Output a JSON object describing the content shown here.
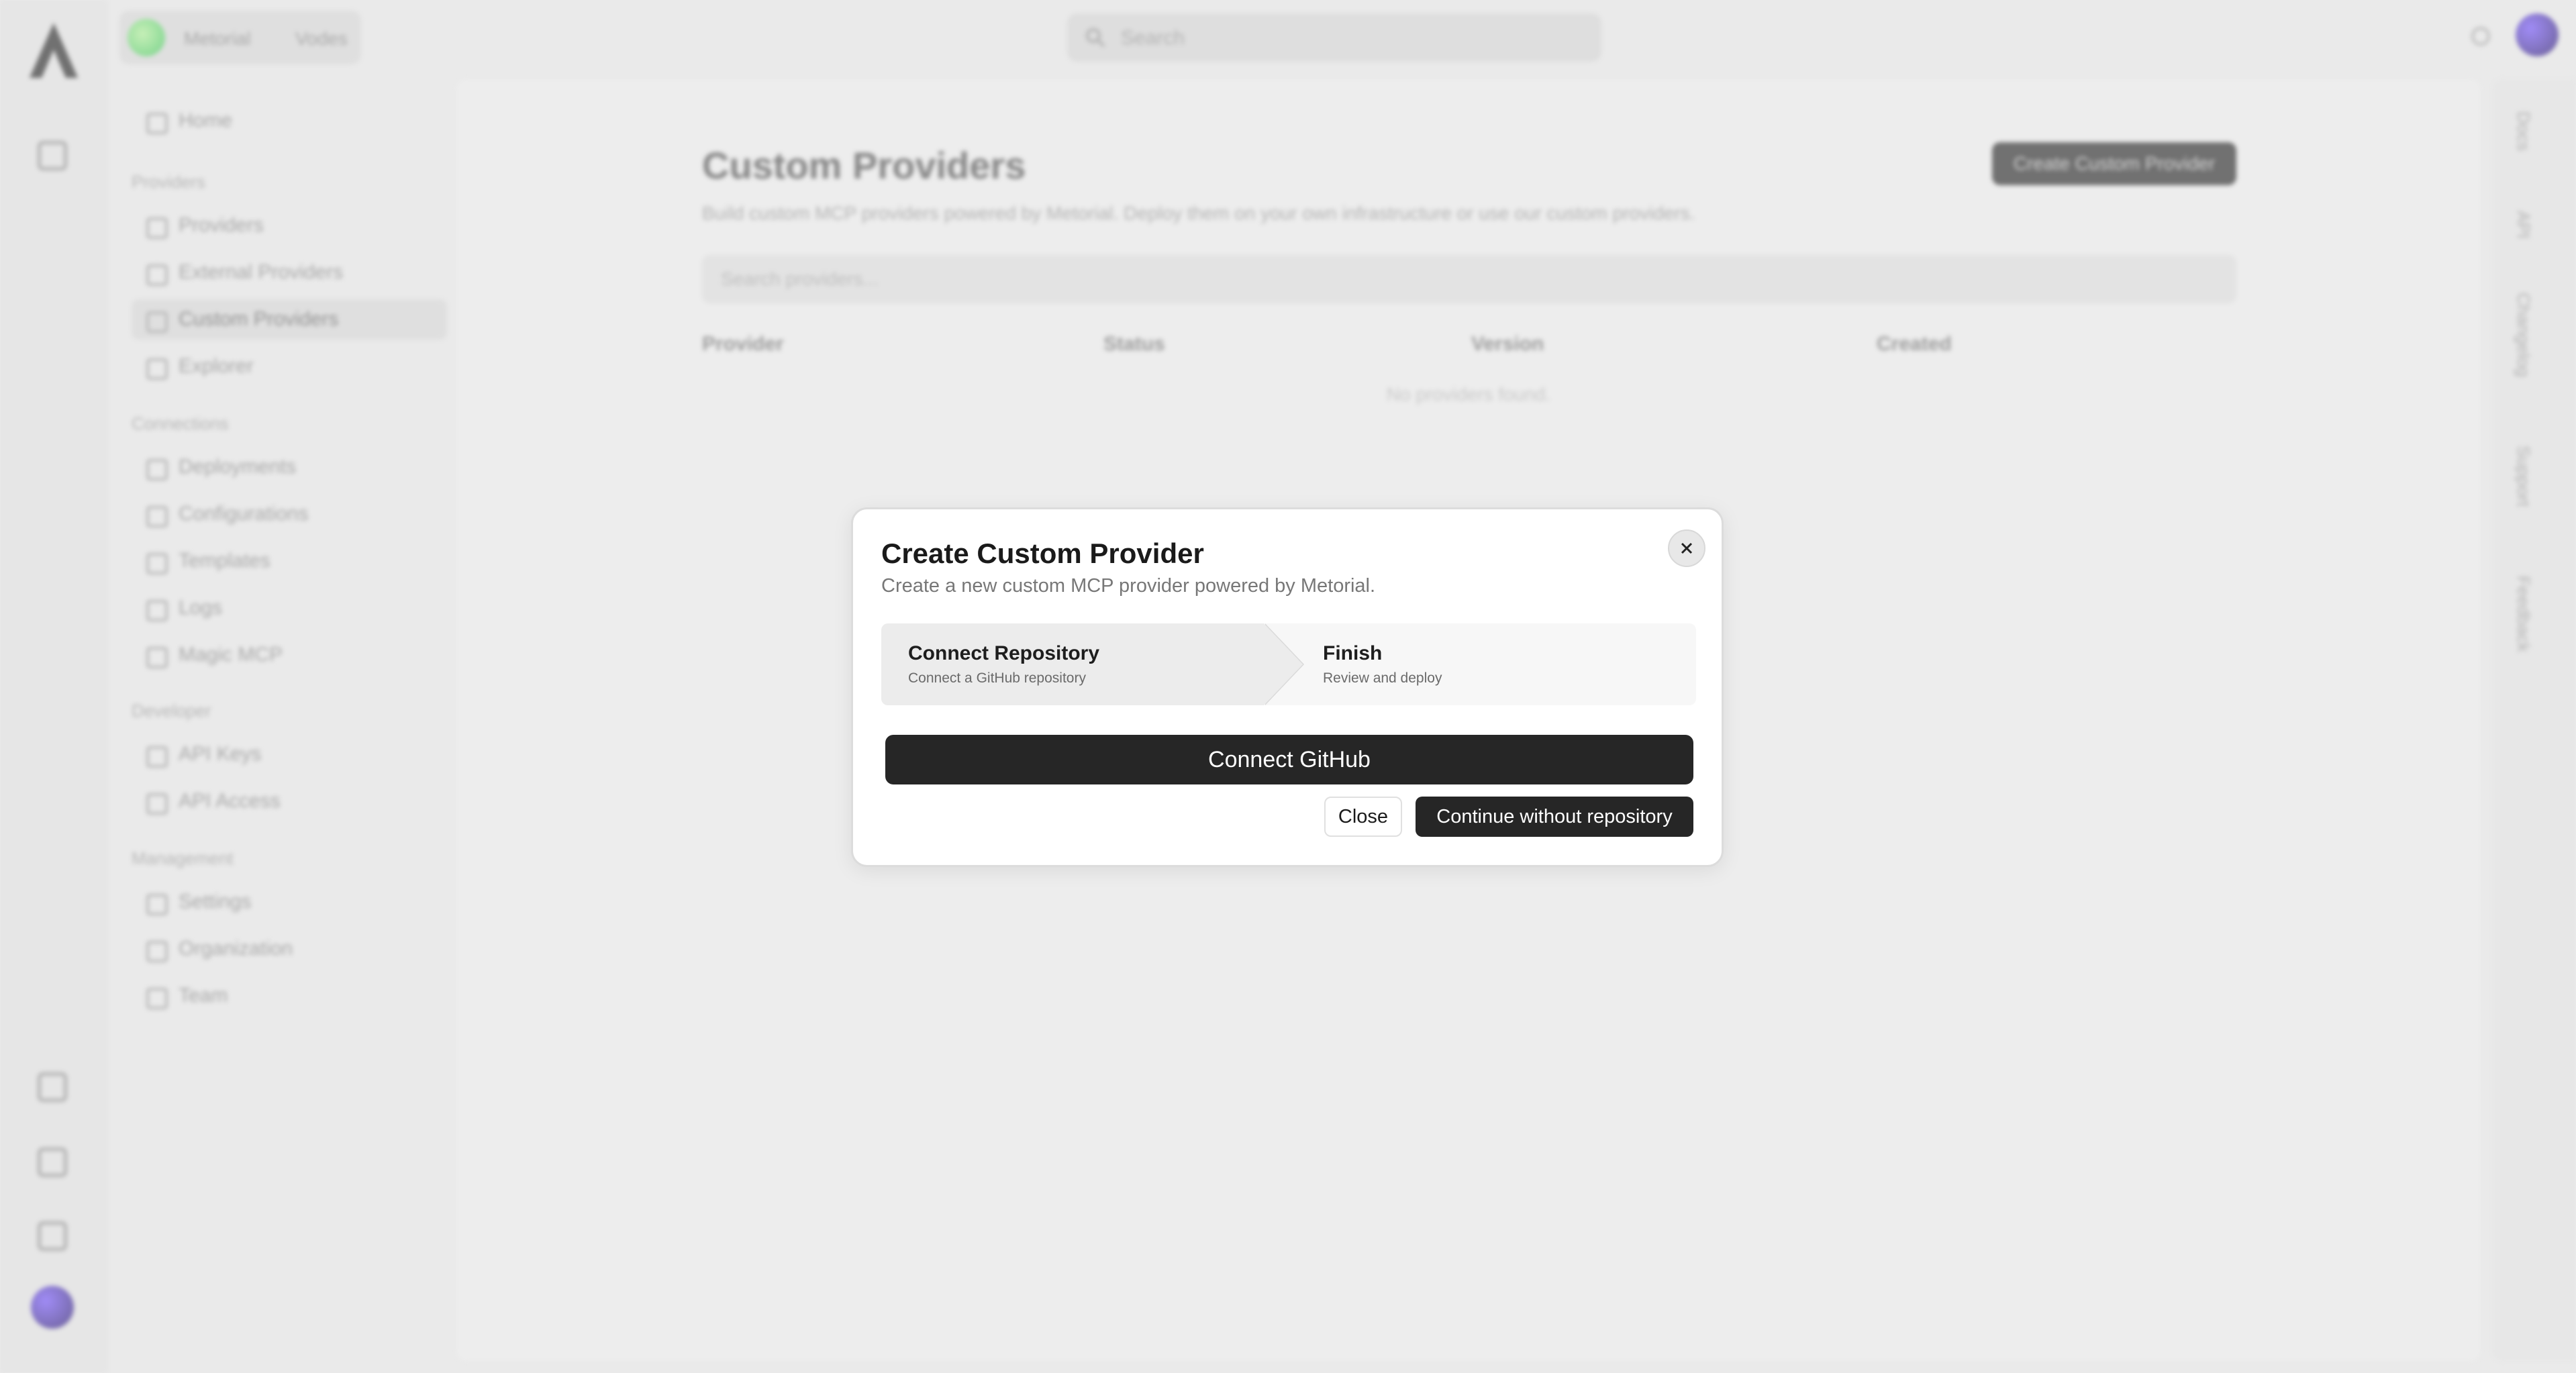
{
  "background": {
    "org": {
      "name": "Metorial",
      "project": "Vodes"
    },
    "search_placeholder": "Search",
    "sidebar": {
      "home": "Home",
      "groups": [
        {
          "label": "Providers",
          "items": [
            "Providers",
            "External Providers",
            "Custom Providers",
            "Explorer"
          ]
        },
        {
          "label": "Connections",
          "items": [
            "Deployments",
            "Configurations",
            "Templates",
            "Logs",
            "Magic MCP"
          ]
        },
        {
          "label": "Developer",
          "items": [
            "API Keys",
            "API Access"
          ]
        },
        {
          "label": "Management",
          "items": [
            "Settings",
            "Organization",
            "Team"
          ]
        }
      ],
      "active_item": "Custom Providers"
    },
    "main": {
      "title": "Custom Providers",
      "subtitle": "Build custom MCP providers powered by Metorial. Deploy them on your own infrastructure or use our custom providers.",
      "create_button": "Create Custom Provider",
      "search_placeholder": "Search providers...",
      "columns": [
        "Provider",
        "Status",
        "Version",
        "Created"
      ],
      "empty_text": "No providers found."
    },
    "right_tabs": [
      "Docs",
      "API",
      "Changelog",
      "Support",
      "Feedback"
    ]
  },
  "modal": {
    "title": "Create Custom Provider",
    "description": "Create a new custom MCP provider powered by Metorial.",
    "steps": [
      {
        "title": "Connect Repository",
        "subtitle": "Connect a GitHub repository",
        "active": true
      },
      {
        "title": "Finish",
        "subtitle": "Review and deploy",
        "active": false
      }
    ],
    "connect_button": "Connect GitHub",
    "close_button": "Close",
    "continue_button": "Continue without repository",
    "close_icon": "x-icon"
  },
  "colors": {
    "primary_button": "#262626",
    "modal_bg": "#ffffff",
    "step_active_bg": "#ececec"
  }
}
